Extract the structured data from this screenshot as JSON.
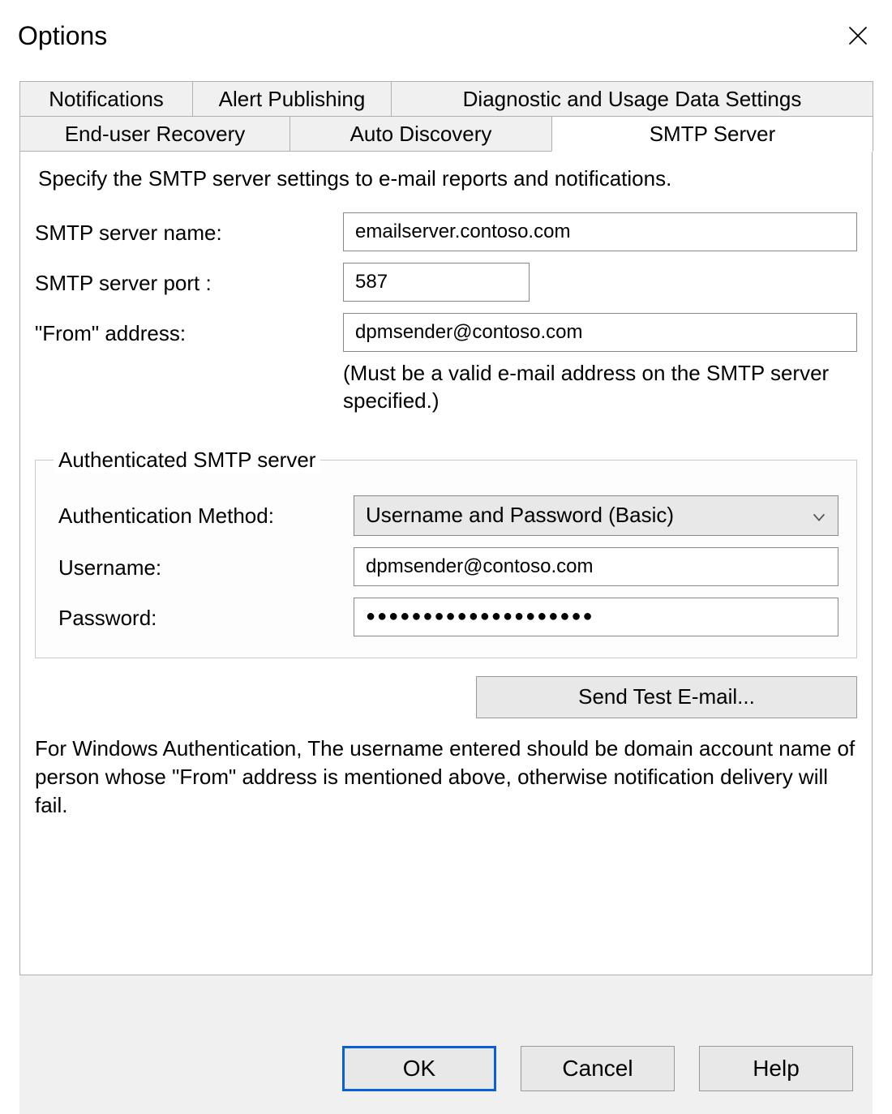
{
  "window": {
    "title": "Options"
  },
  "tabs": {
    "row1": [
      "Notifications",
      "Alert Publishing",
      "Diagnostic and Usage Data Settings"
    ],
    "row2": [
      "End-user Recovery",
      "Auto Discovery",
      "SMTP Server"
    ],
    "active": "SMTP Server"
  },
  "smtp": {
    "description": "Specify the SMTP server settings to e-mail reports and notifications.",
    "server_name_label": "SMTP server name:",
    "server_name_value": "emailserver.contoso.com",
    "server_port_label": "SMTP server port :",
    "server_port_value": "587",
    "from_label": "\"From\" address:",
    "from_value": "dpmsender@contoso.com",
    "from_hint": "(Must be a valid e-mail address on the SMTP server specified.)"
  },
  "auth": {
    "legend": "Authenticated SMTP server",
    "method_label": "Authentication Method:",
    "method_value": "Username and Password (Basic)",
    "username_label": "Username:",
    "username_value": "dpmsender@contoso.com",
    "password_label": "Password:",
    "password_value": "●●●●●●●●●●●●●●●●●●●●"
  },
  "actions": {
    "send_test": "Send Test E-mail...",
    "footnote": "For Windows Authentication, The username entered should be domain account name of person whose \"From\" address is mentioned above, otherwise notification delivery will fail.",
    "ok": "OK",
    "cancel": "Cancel",
    "help": "Help"
  }
}
